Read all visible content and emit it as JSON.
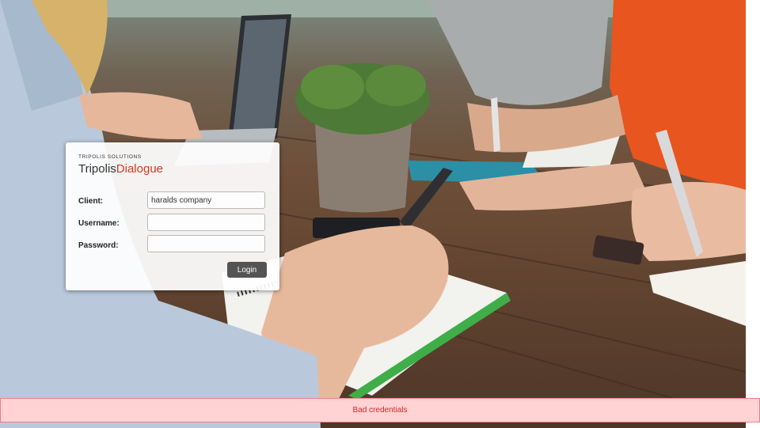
{
  "brand": {
    "company": "TRIPOLIS SOLUTIONS",
    "product_name": "Tripolis",
    "product_accent": "Dialogue",
    "accent_color": "#d23a1e"
  },
  "login": {
    "client_label": "Client:",
    "client_value": "haralds company",
    "username_label": "Username:",
    "username_value": "",
    "password_label": "Password:",
    "password_value": "",
    "button_label": "Login",
    "button_color": "#545454"
  },
  "error": {
    "message": "Bad credentials",
    "background": "#ffd2d4",
    "border": "#e77f85",
    "text_color": "#cc2a2f"
  }
}
